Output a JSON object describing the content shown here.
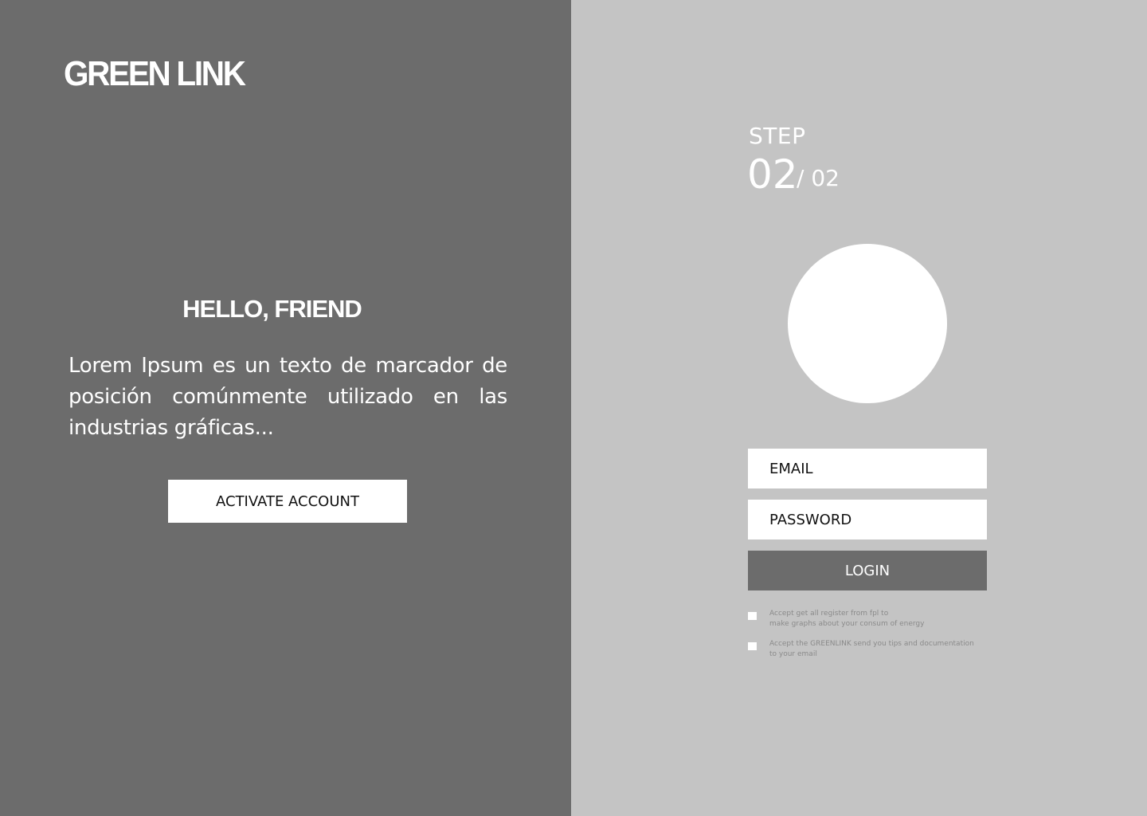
{
  "brand": {
    "logo_text": "GREEN LINK"
  },
  "welcome": {
    "heading": "HELLO, FRIEND",
    "body": "Lorem Ipsum es un texto de marcador de posición comúnmente utilizado en las industrias gráficas...",
    "activate_label": "ACTIVATE ACCOUNT"
  },
  "step": {
    "label": "STEP",
    "current": "02",
    "total": "/ 02"
  },
  "form": {
    "avatar_icon": "avatar-placeholder",
    "email_placeholder": "EMAIL",
    "password_placeholder": "PASSWORD",
    "login_label": "LOGIN",
    "checkboxes": [
      {
        "line1": "Accept get all register from fpl to",
        "line2": "make graphs about your consum of energy",
        "checked": false
      },
      {
        "line1": "Accept the GREENLINK send you tips and documentation",
        "line2": "to your email",
        "checked": false
      }
    ]
  },
  "colors": {
    "left_panel": "#6c6c6c",
    "right_panel": "#c4c4c4",
    "white": "#ffffff",
    "login_button": "#6c6c6c"
  }
}
